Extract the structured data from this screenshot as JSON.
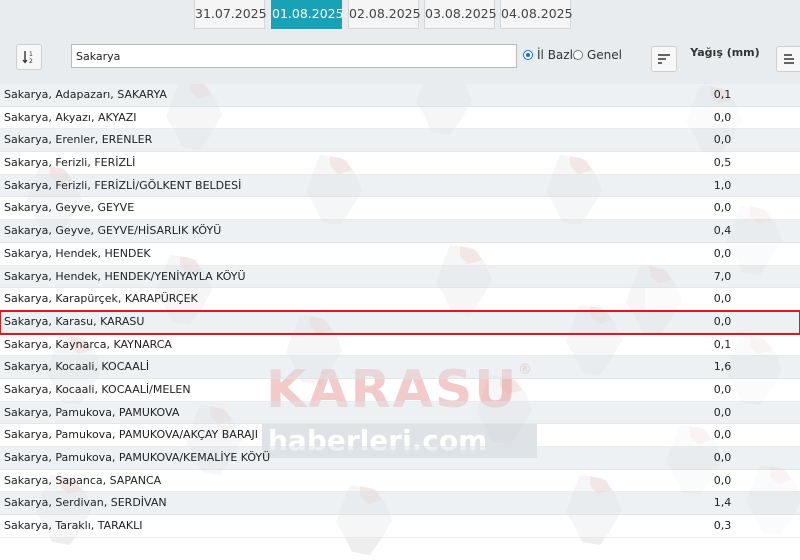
{
  "dates": [
    "31.07.2025",
    "01.08.2025",
    "02.08.2025",
    "03.08.2025",
    "04.08.2025"
  ],
  "active_date_index": 1,
  "filter": {
    "search_value": "Sakarya",
    "radio_il_bazli": "İl Bazlı",
    "radio_genel": "Genel",
    "selected_radio": "il_bazli",
    "column_title": "Yağış (mm)"
  },
  "rows": [
    {
      "location": "Sakarya, Adapazarı, SAKARYA",
      "value": "0,1"
    },
    {
      "location": "Sakarya, Akyazı, AKYAZI",
      "value": "0,0"
    },
    {
      "location": "Sakarya, Erenler, ERENLER",
      "value": "0,0"
    },
    {
      "location": "Sakarya, Ferizli, FERİZLİ",
      "value": "0,5"
    },
    {
      "location": "Sakarya, Ferizli, FERİZLİ/GÖLKENT BELDESİ",
      "value": "1,0"
    },
    {
      "location": "Sakarya, Geyve, GEYVE",
      "value": "0,0"
    },
    {
      "location": "Sakarya, Geyve, GEYVE/HİSARLIK KÖYÜ",
      "value": "0,4"
    },
    {
      "location": "Sakarya, Hendek, HENDEK",
      "value": "0,0"
    },
    {
      "location": "Sakarya, Hendek, HENDEK/YENİYAYLA KÖYÜ",
      "value": "7,0"
    },
    {
      "location": "Sakarya, Karapürçek, KARAPÜRÇEK",
      "value": "0,0"
    },
    {
      "location": "Sakarya, Karasu, KARASU",
      "value": "0,0"
    },
    {
      "location": "Sakarya, Kaynarca, KAYNARCA",
      "value": "0,1"
    },
    {
      "location": "Sakarya, Kocaali, KOCAALİ",
      "value": "1,6"
    },
    {
      "location": "Sakarya, Kocaali, KOCAALİ/MELEN",
      "value": "0,0"
    },
    {
      "location": "Sakarya, Pamukova, PAMUKOVA",
      "value": "0,0"
    },
    {
      "location": "Sakarya, Pamukova, PAMUKOVA/AKÇAY BARAJI",
      "value": "0,0"
    },
    {
      "location": "Sakarya, Pamukova, PAMUKOVA/KEMALİYE KÖYÜ",
      "value": "0,0"
    },
    {
      "location": "Sakarya, Sapanca, SAPANCA",
      "value": "0,0"
    },
    {
      "location": "Sakarya, Serdivan, SERDİVAN",
      "value": "1,4"
    },
    {
      "location": "Sakarya, Taraklı, TARAKLI",
      "value": "0,3"
    }
  ],
  "selected_row_index": 10,
  "highlighted_row_index": 8,
  "watermark": {
    "line1": "KARASU",
    "line2": "haberleri.com",
    "reg": "®"
  },
  "colors": {
    "accent": "#17a2b8",
    "selection": "#e01818",
    "highlight": "#f8c8c8",
    "watermark_red": "#d64e4e"
  },
  "icons": {
    "sort_numeric": "sort-asc-numeric-icon",
    "sort_left": "sort-amount-icon",
    "sort_right": "sort-align-icon"
  }
}
